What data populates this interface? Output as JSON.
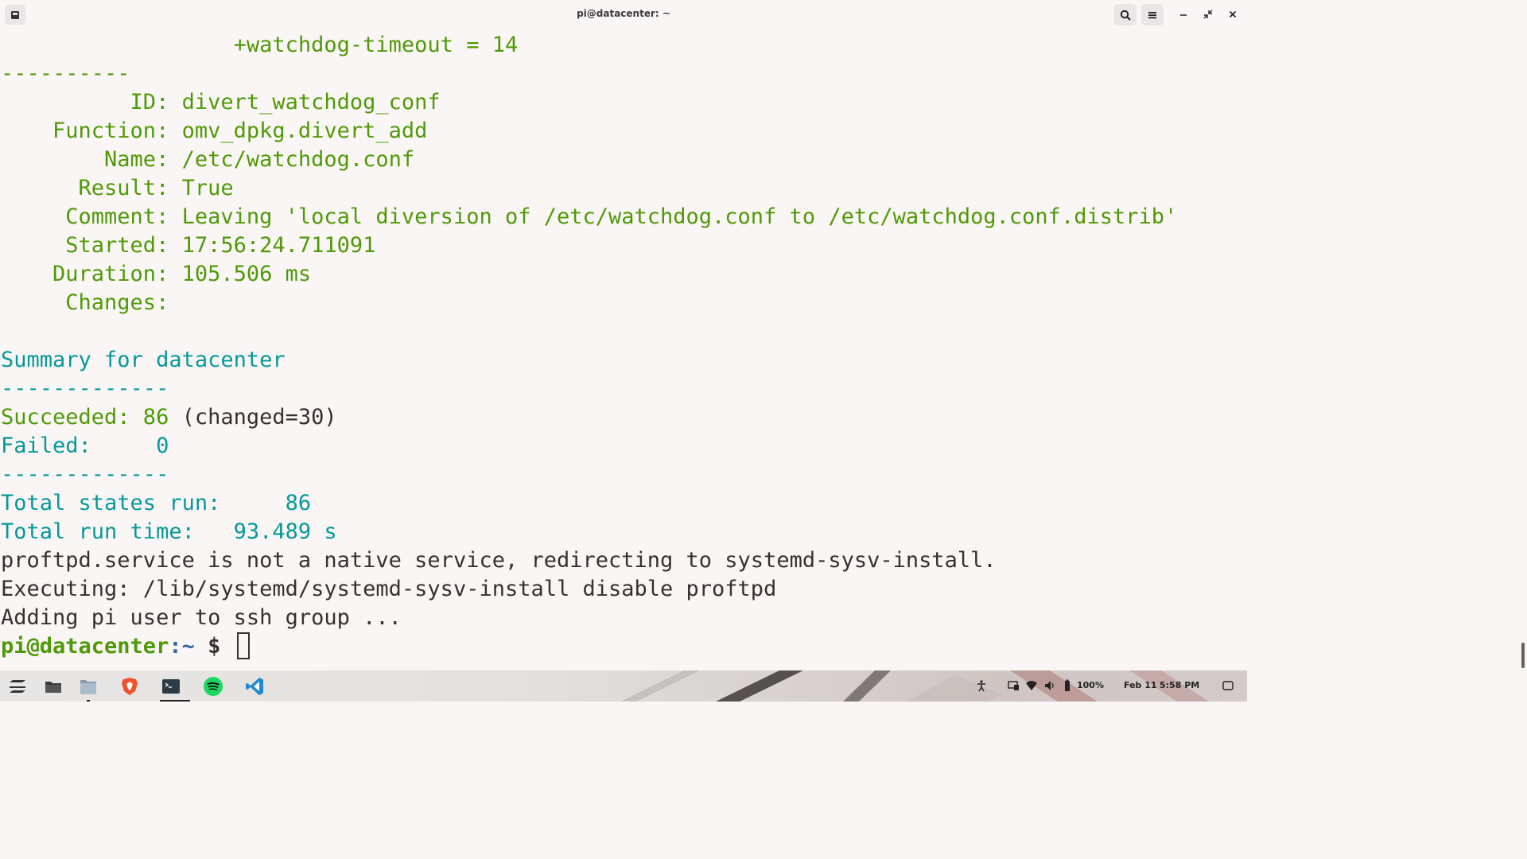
{
  "window": {
    "title": "pi@datacenter: ~"
  },
  "terminal": {
    "lines": [
      "                  +watchdog-timeout = 14",
      "----------",
      "          ID: divert_watchdog_conf",
      "    Function: omv_dpkg.divert_add",
      "        Name: /etc/watchdog.conf",
      "      Result: True",
      "     Comment: Leaving 'local diversion of /etc/watchdog.conf to /etc/watchdog.conf.distrib'",
      "     Started: 17:56:24.711091",
      "    Duration: 105.506 ms",
      "     Changes:",
      "",
      "Summary for datacenter",
      "-------------",
      "Succeeded: 86 ",
      "Failed:     0",
      "-------------",
      "Total states run:     86",
      "Total run time:   93.489 s",
      "proftpd.service is not a native service, redirecting to systemd-sysv-install.",
      "Executing: /lib/systemd/systemd-sysv-install disable proftpd",
      "Adding pi user to ssh group ..."
    ],
    "succeeded_changed": "(changed=30)",
    "prompt_user": "pi@datacenter",
    "prompt_path": ":~",
    "prompt_symbol": " $ "
  },
  "taskbar": {
    "apps": [
      "zorin-menu-icon",
      "files-icon",
      "documents-icon",
      "brave-icon",
      "terminal-icon",
      "spotify-icon",
      "vscode-icon"
    ],
    "battery": "100%",
    "date": "Feb 11",
    "time": "5:58 PM"
  },
  "colors": {
    "background": "#fbf6f6",
    "green": "#4e9a06",
    "teal": "#06989a",
    "text": "#3a2f2f"
  }
}
